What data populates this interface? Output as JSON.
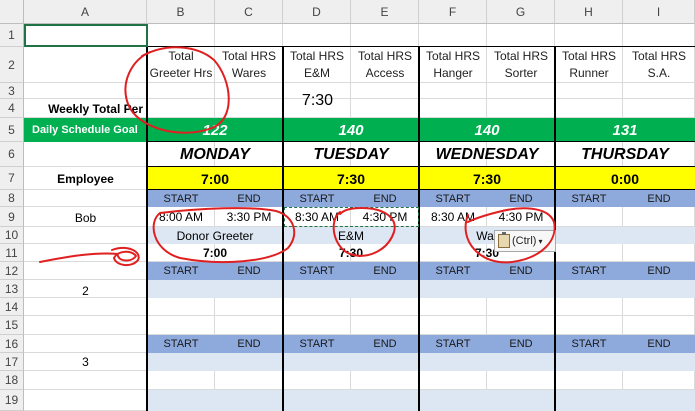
{
  "columns": [
    "A",
    "B",
    "C",
    "D",
    "E",
    "F",
    "G",
    "H",
    "I"
  ],
  "rows": [
    "1",
    "2",
    "3",
    "4",
    "5",
    "6",
    "7",
    "8",
    "9",
    "10",
    "11",
    "12",
    "13",
    "14",
    "15",
    "16",
    "17",
    "18",
    "19"
  ],
  "task_headers": [
    "Total Greeter Hrs",
    "Total HRS Wares",
    "Total HRS E&M",
    "Total HRS Access",
    "Total HRS Hanger",
    "Total HRS Sorter",
    "Total HRS Runner",
    "Total HRS S.A."
  ],
  "weekly_total_label": "Weekly Total Per",
  "weekly_total_em": "7:30",
  "daily_goal_label": "Daily Schedule Goal",
  "daily_goals": [
    "122",
    "140",
    "140",
    "131"
  ],
  "days": [
    "MONDAY",
    "TUESDAY",
    "WEDNESDAY",
    "THURSDAY"
  ],
  "employee_label": "Employee",
  "day_totals": [
    "7:00",
    "7:30",
    "7:30",
    "0:00"
  ],
  "start_label": "START",
  "end_label": "END",
  "employees": [
    "Bob",
    "2",
    "3"
  ],
  "bob_shifts": [
    {
      "start": "8:00 AM",
      "end": "3:30 PM",
      "role": "Donor Greeter",
      "hours": "7:00"
    },
    {
      "start": "8:30 AM",
      "end": "4:30 PM",
      "role": "E&M",
      "hours": "7:30"
    },
    {
      "start": "8:30 AM",
      "end": "4:30 PM",
      "role": "War",
      "hours": "7:30"
    }
  ],
  "paste_options_label": "(Ctrl)",
  "colors": {
    "green": "#00b050",
    "yellow": "#ffff00",
    "blue": "#8ea9db",
    "light_blue": "#dde7f3",
    "annotation_red": "#e02020",
    "selection_green": "#217346"
  }
}
